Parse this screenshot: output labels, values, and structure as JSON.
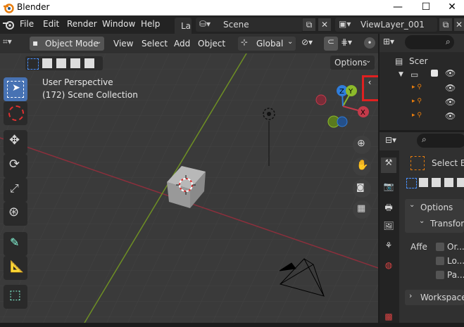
{
  "window": {
    "title": "Blender",
    "minimize": "—",
    "maximize": "☐",
    "close": "✕"
  },
  "menubar": {
    "items": [
      "File",
      "Edit",
      "Render",
      "Window",
      "Help"
    ],
    "workspace_tab": "La",
    "scene_name": "Scene",
    "view_layer": "ViewLayer_001"
  },
  "viewport_header": {
    "mode": "Object Mode",
    "menus": [
      "View",
      "Select",
      "Add",
      "Object"
    ],
    "orientation": "Global",
    "options_label": "Options"
  },
  "viewport": {
    "perspective_label": "User Perspective",
    "collection_label": "(172) Scene Collection",
    "gizmo": {
      "x": "X",
      "y": "Y",
      "z": "Z"
    }
  },
  "outliner": {
    "scene_label": "Scer"
  },
  "properties": {
    "tool_name": "Select Bo",
    "options_panel": "Options",
    "transform_panel": "Transform",
    "affect_label": "Affe",
    "affect_options": [
      "Or...",
      "Lo...",
      "Pa..."
    ],
    "workspace_panel": "Workspace"
  },
  "colors": {
    "highlight": "#e02020",
    "x_axis": "#c43a4a",
    "y_axis": "#8cba2a",
    "accent": "#4772b3"
  }
}
